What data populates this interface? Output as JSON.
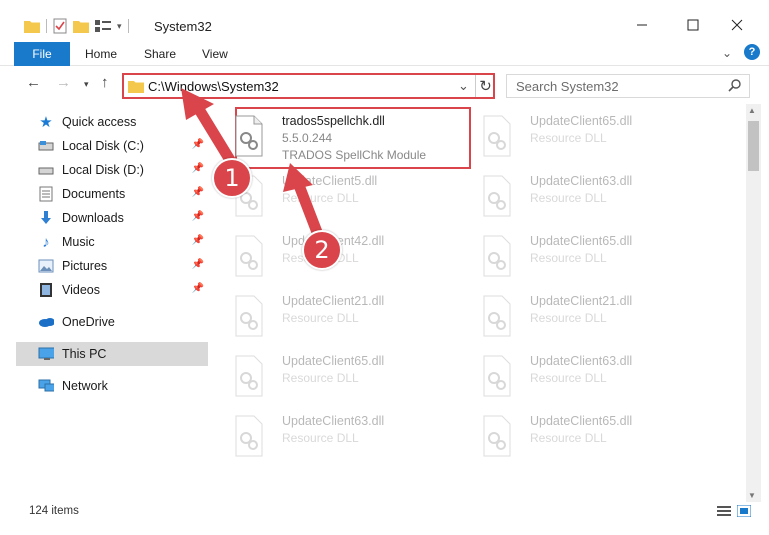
{
  "window": {
    "title": "System32"
  },
  "ribbon": {
    "tabs": [
      "File",
      "Home",
      "Share",
      "View"
    ],
    "help": "?"
  },
  "address": {
    "path": "C:\\Windows\\System32"
  },
  "search": {
    "placeholder": "Search System32"
  },
  "sidebar": {
    "items": [
      {
        "label": "Quick access",
        "icon": "star-icon"
      },
      {
        "label": "Local Disk (C:)",
        "icon": "drive-icon",
        "pinned": true
      },
      {
        "label": "Local Disk (D:)",
        "icon": "drive-icon",
        "pinned": true
      },
      {
        "label": "Documents",
        "icon": "documents-icon",
        "pinned": true
      },
      {
        "label": "Downloads",
        "icon": "downloads-icon",
        "pinned": true
      },
      {
        "label": "Music",
        "icon": "music-icon",
        "pinned": true
      },
      {
        "label": "Pictures",
        "icon": "pictures-icon",
        "pinned": true
      },
      {
        "label": "Videos",
        "icon": "videos-icon",
        "pinned": true
      },
      {
        "label": "OneDrive",
        "icon": "onedrive-icon"
      },
      {
        "label": "This PC",
        "icon": "pc-icon",
        "selected": true
      },
      {
        "label": "Network",
        "icon": "network-icon"
      }
    ]
  },
  "files": {
    "highlighted": {
      "name": "trados5spellchk.dll",
      "version": "5.5.0.244",
      "description": "TRADOS SpellChk Module"
    },
    "left": [
      {
        "name": "UpdateClient5.dll",
        "type": "Resource DLL"
      },
      {
        "name": "UpdateClient42.dll",
        "type": "Resource DLL"
      },
      {
        "name": "UpdateClient21.dll",
        "type": "Resource DLL"
      },
      {
        "name": "UpdateClient65.dll",
        "type": "Resource DLL"
      },
      {
        "name": "UpdateClient63.dll",
        "type": "Resource DLL"
      }
    ],
    "right": [
      {
        "name": "UpdateClient65.dll",
        "type": "Resource DLL"
      },
      {
        "name": "UpdateClient63.dll",
        "type": "Resource DLL"
      },
      {
        "name": "UpdateClient65.dll",
        "type": "Resource DLL"
      },
      {
        "name": "UpdateClient21.dll",
        "type": "Resource DLL"
      },
      {
        "name": "UpdateClient63.dll",
        "type": "Resource DLL"
      },
      {
        "name": "UpdateClient65.dll",
        "type": "Resource DLL"
      }
    ]
  },
  "status": {
    "item_count": "124 items"
  },
  "annotations": {
    "badge1": "1",
    "badge2": "2",
    "color": "#d9454a"
  }
}
